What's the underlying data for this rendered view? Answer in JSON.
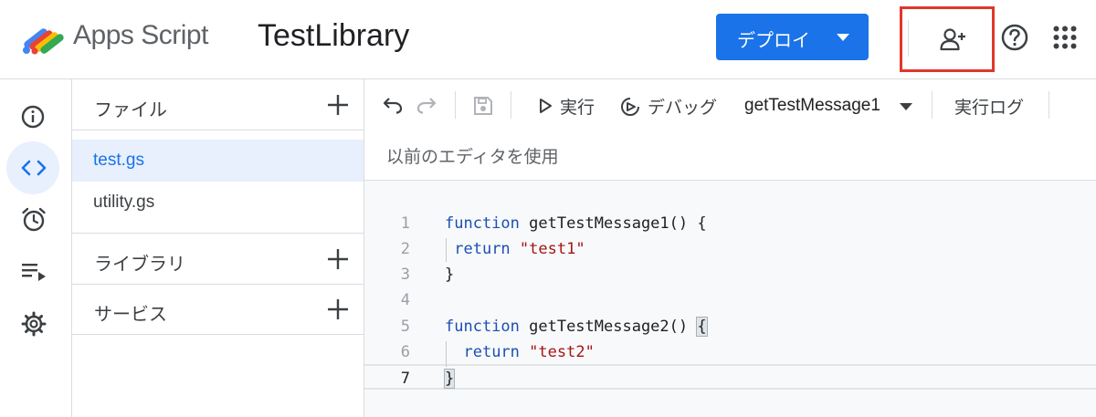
{
  "colors": {
    "accent": "#1a73e8",
    "highlight_box": "#e0372c",
    "active_bg": "#e8f0fe"
  },
  "header": {
    "brand": "Apps Script",
    "project_title": "TestLibrary",
    "deploy_label": "デプロイ",
    "icons": [
      "apps-script-logo",
      "add-person-icon",
      "help-icon",
      "apps-grid-icon"
    ]
  },
  "rail": {
    "items": [
      {
        "name": "overview",
        "icon": "info-icon"
      },
      {
        "name": "editor",
        "icon": "code-icon",
        "active": true
      },
      {
        "name": "triggers",
        "icon": "alarm-icon"
      },
      {
        "name": "executions",
        "icon": "play-list-icon"
      },
      {
        "name": "settings",
        "icon": "gear-icon"
      }
    ]
  },
  "files_panel": {
    "files_label": "ファイル",
    "files": [
      {
        "name": "test.gs",
        "active": true
      },
      {
        "name": "utility.gs",
        "active": false
      }
    ],
    "libraries_label": "ライブラリ",
    "services_label": "サービス"
  },
  "toolbar": {
    "run_label": "実行",
    "debug_label": "デバッグ",
    "function_select": "getTestMessage1",
    "log_label": "実行ログ",
    "legacy_editor_label": "以前のエディタを使用"
  },
  "editor": {
    "current_line": 7,
    "lines": [
      {
        "n": "1",
        "text": "function getTestMessage1() {"
      },
      {
        "n": "2",
        "text": " return \"test1\""
      },
      {
        "n": "3",
        "text": "}"
      },
      {
        "n": "4",
        "text": ""
      },
      {
        "n": "5",
        "text": "function getTestMessage2() {"
      },
      {
        "n": "6",
        "text": "  return \"test2\""
      },
      {
        "n": "7",
        "text": "}"
      }
    ]
  }
}
